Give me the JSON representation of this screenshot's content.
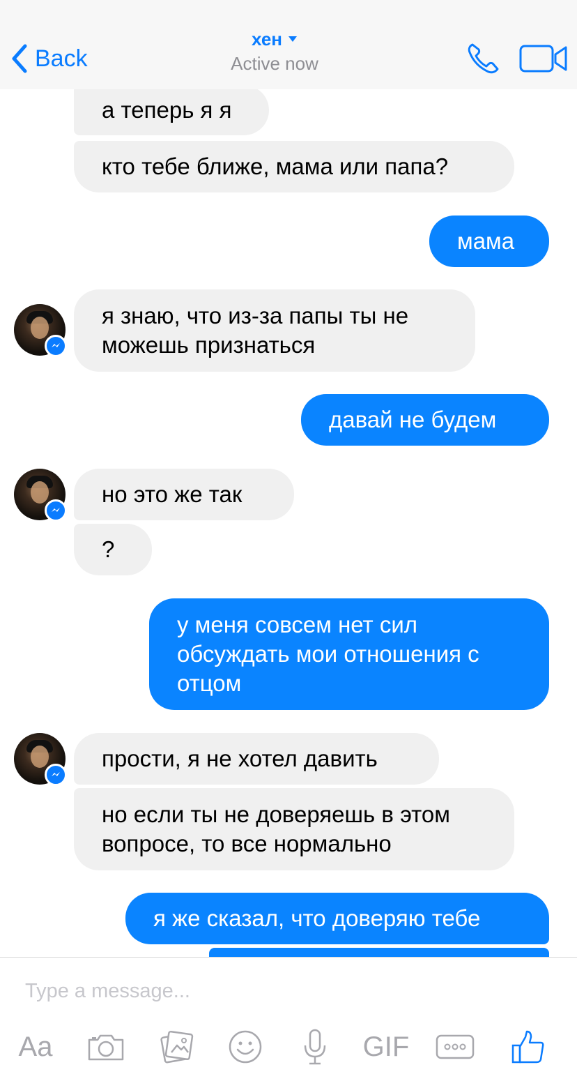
{
  "header": {
    "back_label": "Back",
    "contact_name": "хен",
    "status": "Active now"
  },
  "colors": {
    "accent": "#0a7cff",
    "outgoing_bubble": "#0a84ff",
    "incoming_bubble": "#f0f0f0"
  },
  "messages": [
    {
      "side": "in",
      "text": "а теперь я я"
    },
    {
      "side": "in",
      "text": "кто тебе ближе, мама или папа?"
    },
    {
      "side": "out",
      "text": "мама"
    },
    {
      "side": "in",
      "text": "я знаю, что из-за папы ты не можешь признаться"
    },
    {
      "side": "out",
      "text": "давай не будем"
    },
    {
      "side": "in",
      "text": "но это же так"
    },
    {
      "side": "in",
      "text": "?"
    },
    {
      "side": "out",
      "text": "у меня совсем нет сил обсуждать мои отношения с отцом"
    },
    {
      "side": "in",
      "text": "прости, я не хотел давить"
    },
    {
      "side": "in",
      "text": "но если ты не доверяешь в этом вопросе, то все нормально"
    },
    {
      "side": "out",
      "text": "я же сказал, что доверяю тебе"
    }
  ],
  "composer": {
    "placeholder": "Type a message...",
    "text_tool_label": "Aa",
    "gif_label": "GIF"
  },
  "icons": [
    "chevron-left-icon",
    "caret-down-icon",
    "phone-icon",
    "video-camera-icon",
    "messenger-badge-icon",
    "camera-icon",
    "photo-icon",
    "emoji-icon",
    "microphone-icon",
    "more-icon",
    "thumbs-up-icon"
  ]
}
